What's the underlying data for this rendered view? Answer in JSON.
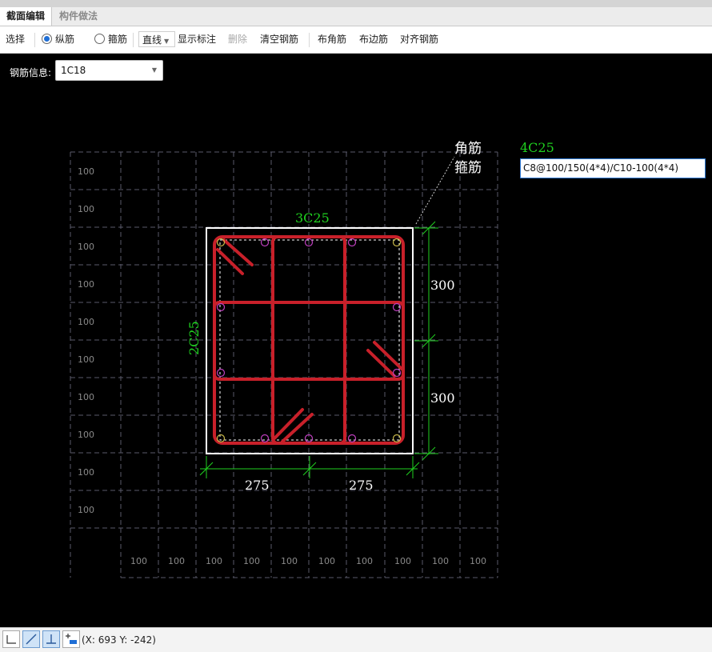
{
  "tabs": [
    {
      "label": "截面编辑",
      "active": true
    },
    {
      "label": "构件做法",
      "active": false
    }
  ],
  "toolbar": {
    "select": "选择",
    "longitudinal": "纵筋",
    "stirrup": "箍筋",
    "line_mode": "直线",
    "show_label": "显示标注",
    "delete": "删除",
    "clear_rebar": "清空钢筋",
    "corner_rebar": "布角筋",
    "edge_rebar": "布边筋",
    "align_rebar": "对齐钢筋",
    "selected_radio": "纵筋"
  },
  "rebar_info": {
    "label": "钢筋信息:",
    "value": "1C18"
  },
  "drawing": {
    "corner_label": "角筋",
    "stirrup_label": "箍筋",
    "corner_spec": "4C25",
    "stirrup_spec": "C8@100/150(4*4)/C10-100(4*4)",
    "top_edge_spec": "3C25",
    "side_edge_spec": "2C25",
    "dim_right": [
      "300",
      "300"
    ],
    "dim_bottom": [
      "275",
      "275"
    ],
    "grid_row_label": "100",
    "grid_col_label": "100"
  },
  "status": {
    "coords": "(X: 693 Y: -242)"
  },
  "colors": {
    "rebar_red": "#c8202a",
    "dim_green": "#1fd01f",
    "corner_bar": "#c8b84a",
    "edge_bar": "#c040c0",
    "grid": "#5a5a6a"
  }
}
